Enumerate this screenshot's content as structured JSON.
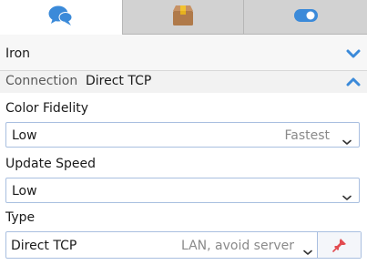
{
  "tabs": [
    {
      "icon": "chat-bubbles-icon",
      "active": true
    },
    {
      "icon": "package-box-icon",
      "active": false
    },
    {
      "icon": "toggle-switch-icon",
      "active": false
    }
  ],
  "colors": {
    "accent": "#3b8ad9",
    "border": "#a9bfe0",
    "pin": "#e24b50",
    "box": "#b07a4a"
  },
  "profile": {
    "name": "Iron"
  },
  "connection": {
    "label": "Connection",
    "value": "Direct TCP"
  },
  "settings": {
    "color_fidelity": {
      "label": "Color Fidelity",
      "value": "Low",
      "hint": "Fastest"
    },
    "update_speed": {
      "label": "Update Speed",
      "value": "Low"
    },
    "type": {
      "label": "Type",
      "value": "Direct TCP",
      "hint": "LAN, avoid server"
    }
  }
}
